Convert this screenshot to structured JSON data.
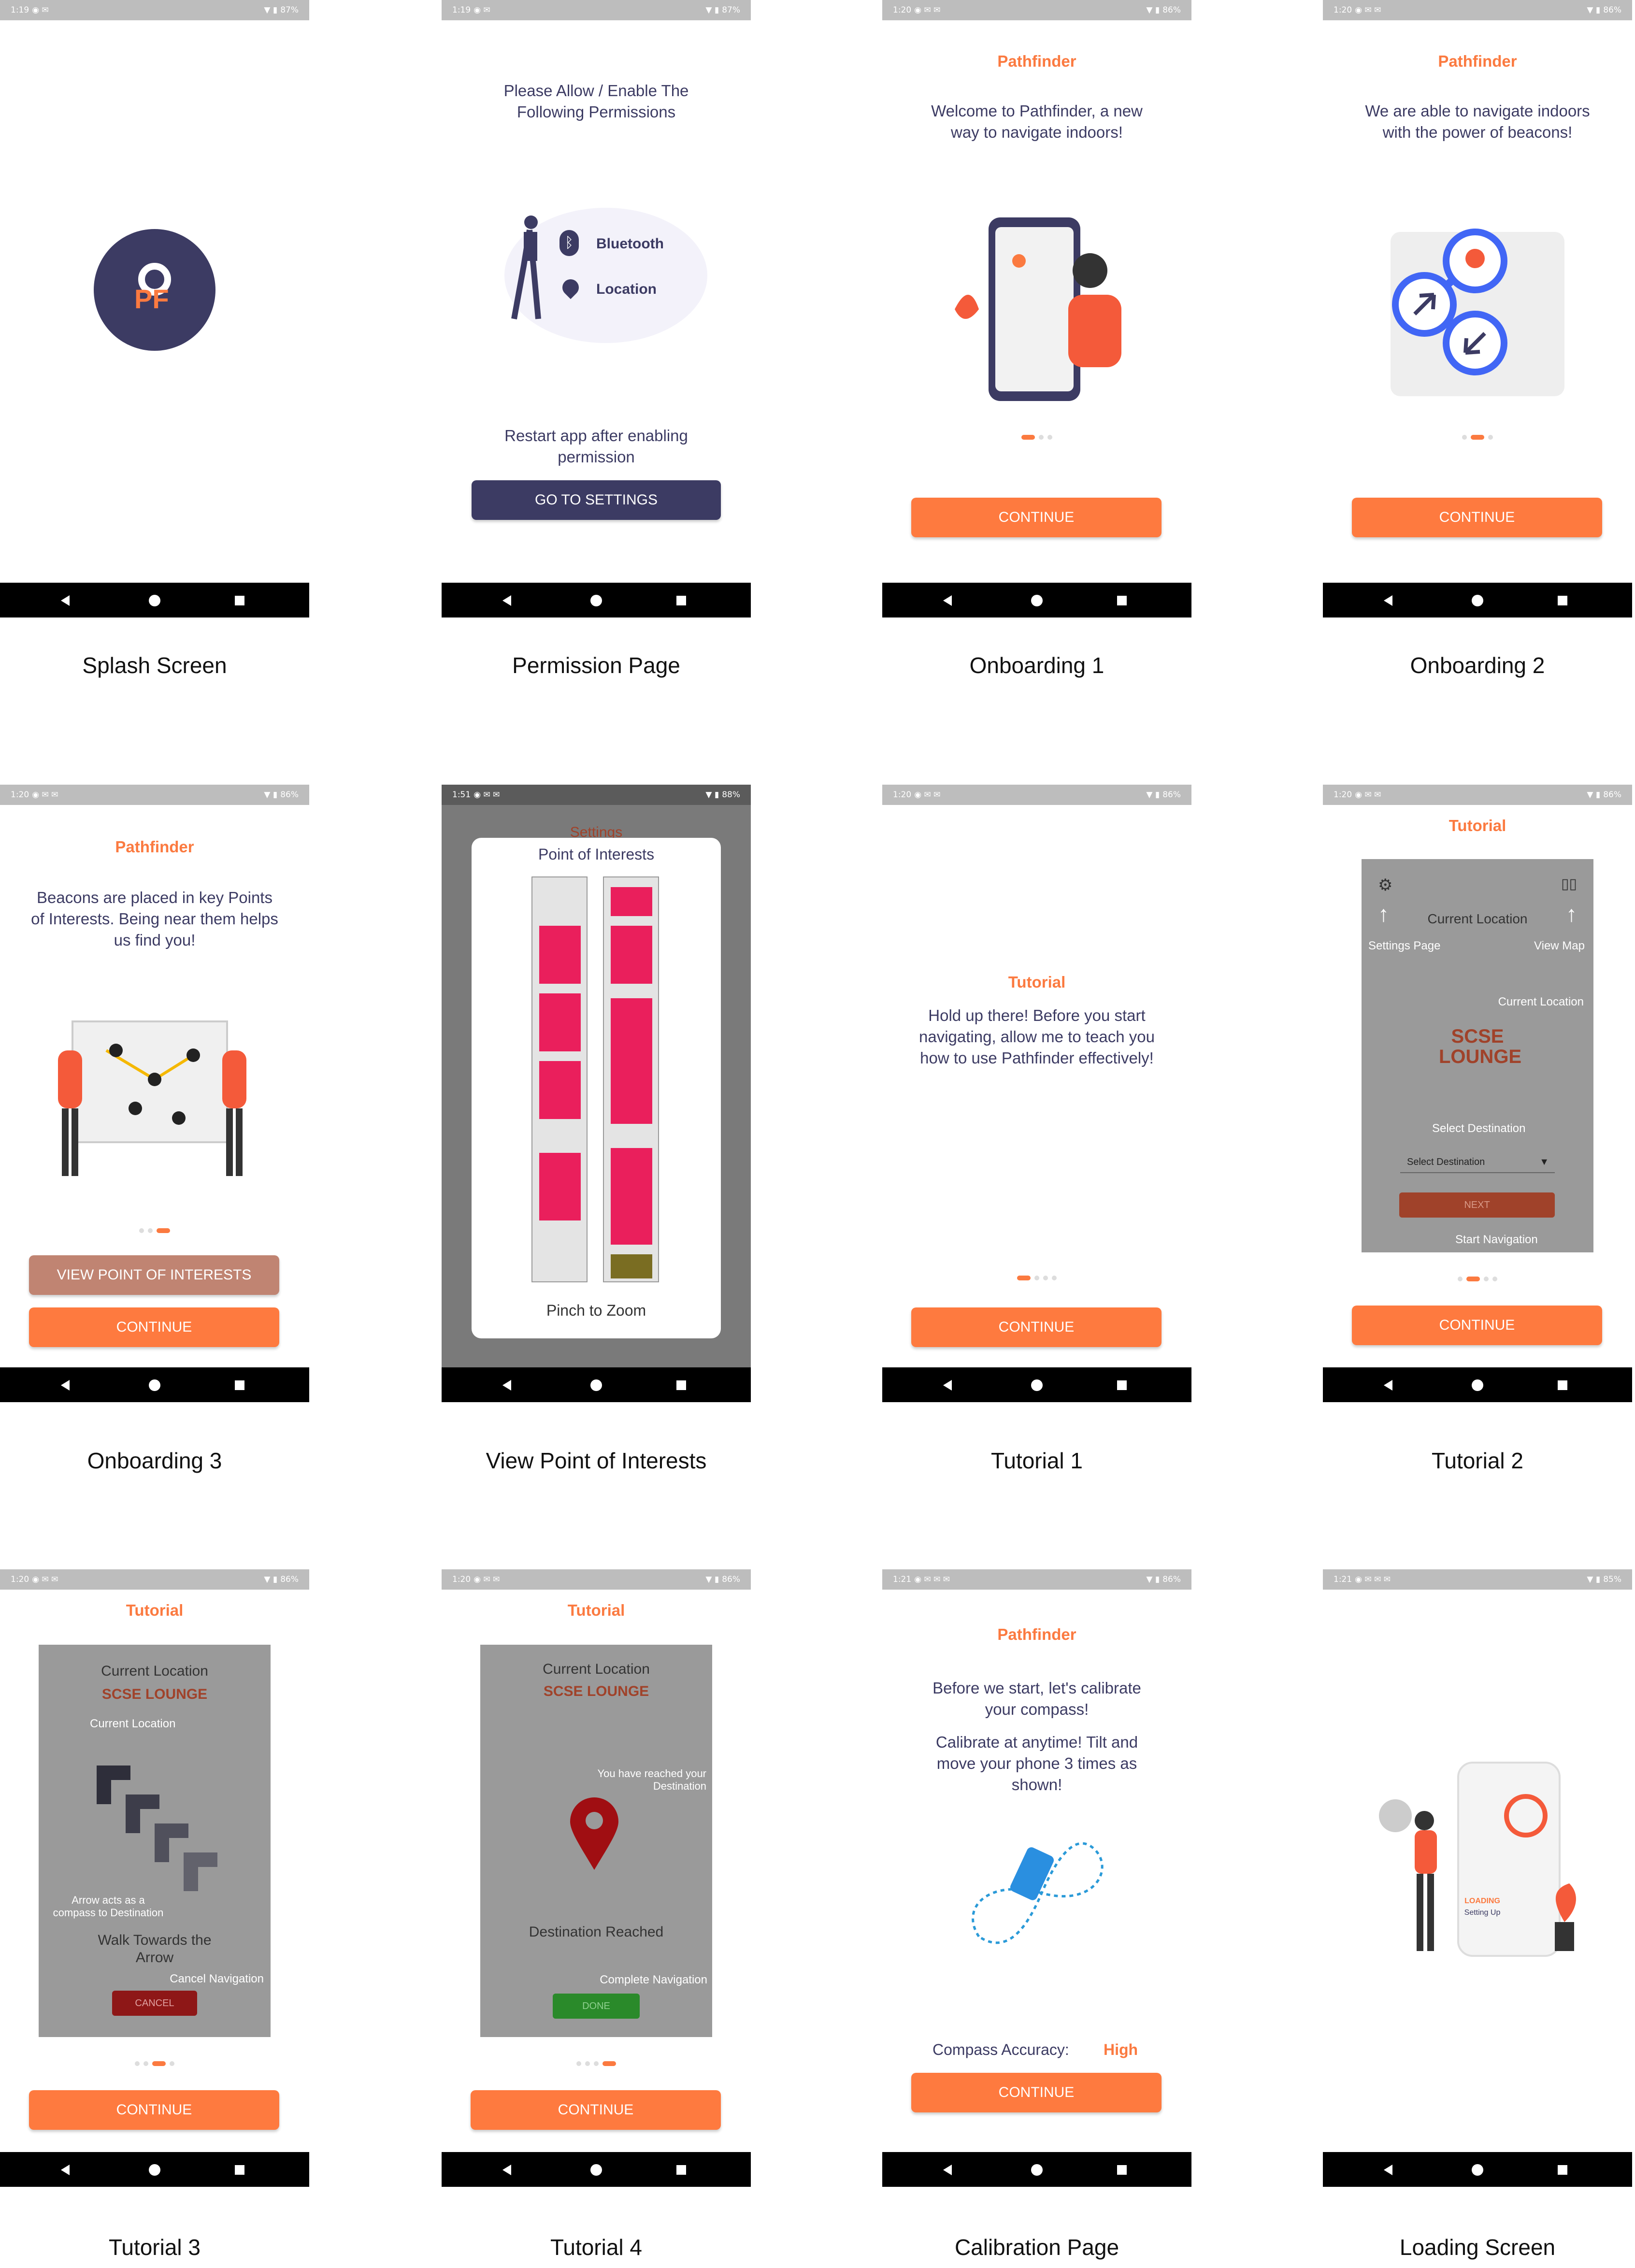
{
  "colors": {
    "accent": "#fe7a3f",
    "navy": "#3c3b63",
    "gray": "#9a9a9a",
    "red": "#8e1717",
    "green": "#2a8a2a",
    "brown": "#c08472"
  },
  "screens": [
    {
      "id": "splash",
      "status": {
        "time": "1:19",
        "battery": "87%"
      },
      "logo": "PF",
      "caption": "Splash Screen"
    },
    {
      "id": "permission",
      "status": {
        "time": "1:19",
        "battery": "87%"
      },
      "title": "Please Allow / Enable The Following Permissions",
      "perm1": "Bluetooth",
      "perm2": "Location",
      "note": "Restart app after enabling permission",
      "button": "GO TO SETTINGS",
      "caption": "Permission Page"
    },
    {
      "id": "onb1",
      "status": {
        "time": "1:20",
        "battery": "86%"
      },
      "header": "Pathfinder",
      "text": "Welcome to Pathfinder, a new way to navigate indoors!",
      "button": "CONTINUE",
      "caption": "Onboarding 1"
    },
    {
      "id": "onb2",
      "status": {
        "time": "1:20",
        "battery": "86%"
      },
      "header": "Pathfinder",
      "text": "We are able to navigate indoors with the power of beacons!",
      "button": "CONTINUE",
      "caption": "Onboarding 2"
    },
    {
      "id": "onb3",
      "status": {
        "time": "1:20",
        "battery": "86%"
      },
      "header": "Pathfinder",
      "text": "Beacons are placed in key Points of Interests. Being near them helps us find you!",
      "button_poi": "VIEW POINT OF INTERESTS",
      "button": "CONTINUE",
      "caption": "Onboarding 3"
    },
    {
      "id": "poi",
      "status": {
        "time": "1:51",
        "battery": "88%"
      },
      "behind": "Settings",
      "title": "Point of Interests",
      "footer": "Pinch to Zoom",
      "caption": "View Point of Interests"
    },
    {
      "id": "tut1",
      "status": {
        "time": "1:20",
        "battery": "86%"
      },
      "header": "Tutorial",
      "text": "Hold up there! Before you start navigating, allow me to teach you how to use Pathfinder effectively!",
      "button": "CONTINUE",
      "caption": "Tutorial 1"
    },
    {
      "id": "tut2",
      "status": {
        "time": "1:20",
        "battery": "86%"
      },
      "header": "Tutorial",
      "current": "Current Location",
      "settings": "Settings Page",
      "viewmap": "View Map",
      "cl_hint": "Current Location",
      "place": "SCSE LOUNGE",
      "sel_hint": "Select Destination",
      "select": "Select Destination",
      "next": "NEXT",
      "start": "Start Navigation",
      "button": "CONTINUE",
      "caption": "Tutorial 2"
    },
    {
      "id": "tut3",
      "status": {
        "time": "1:20",
        "battery": "86%"
      },
      "header": "Tutorial",
      "current": "Current Location",
      "place": "SCSE LOUNGE",
      "cl_hint": "Current Location",
      "arrow_hint": "Arrow acts as a compass to Destination",
      "walk": "Walk Towards the Arrow",
      "cancel_hint": "Cancel Navigation",
      "cancel": "CANCEL",
      "button": "CONTINUE",
      "caption": "Tutorial 3"
    },
    {
      "id": "tut4",
      "status": {
        "time": "1:20",
        "battery": "86%"
      },
      "header": "Tutorial",
      "current": "Current Location",
      "place": "SCSE LOUNGE",
      "reached_hint": "You have reached your Destination",
      "reached": "Destination Reached",
      "complete_hint": "Complete Navigation",
      "done": "DONE",
      "button": "CONTINUE",
      "caption": "Tutorial 4"
    },
    {
      "id": "calib",
      "status": {
        "time": "1:21",
        "battery": "86%"
      },
      "header": "Pathfinder",
      "text1": "Before we start, let's calibrate your compass!",
      "text2": "Calibrate at anytime! Tilt and move your phone 3 times as shown!",
      "acc_label": "Compass Accuracy:",
      "acc_value": "High",
      "button": "CONTINUE",
      "caption": "Calibration Page"
    },
    {
      "id": "loading",
      "status": {
        "time": "1:21",
        "battery": "85%"
      },
      "loading": "LOADING",
      "setting": "Setting Up",
      "caption": "Loading Screen"
    }
  ]
}
